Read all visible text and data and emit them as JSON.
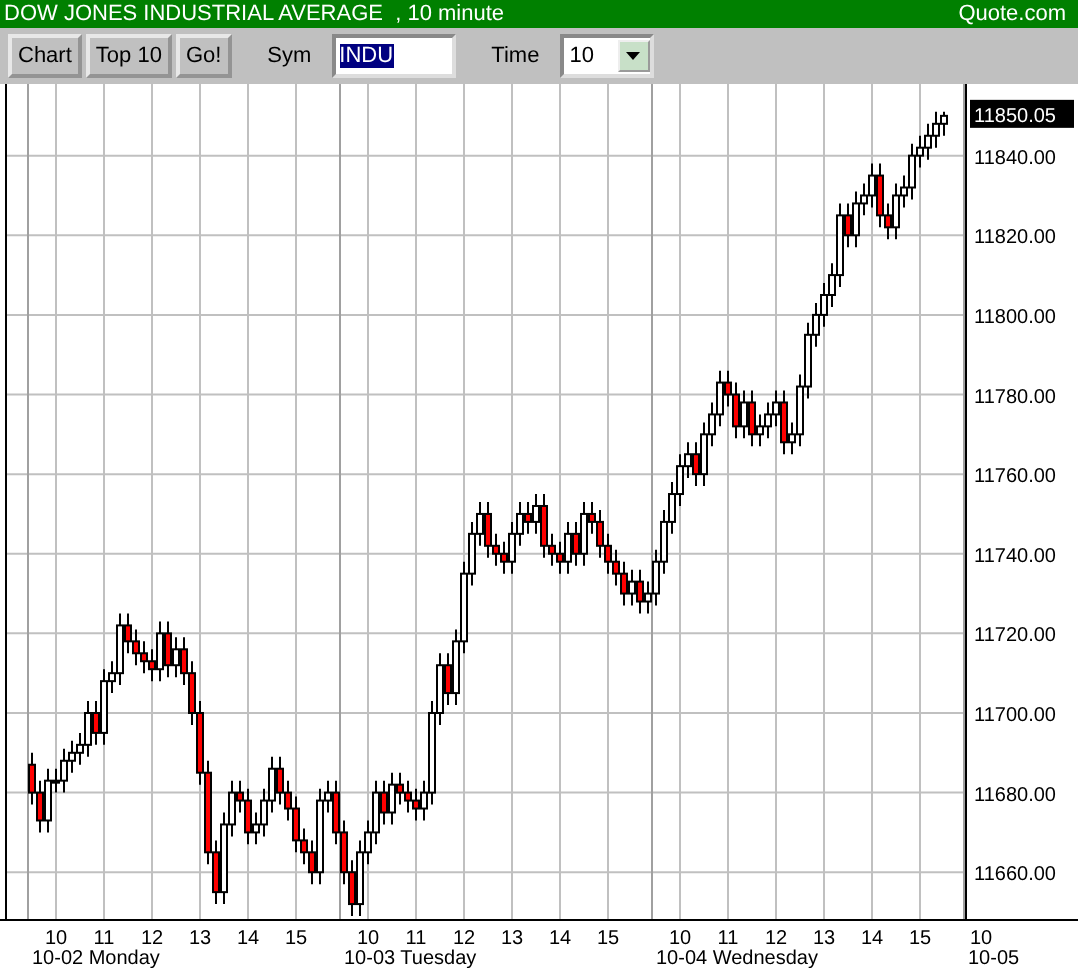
{
  "title_bar": {
    "title": "DOW JONES INDUSTRIAL AVERAGE  , 10 minute",
    "brand": "Quote.com"
  },
  "toolbar": {
    "buttons": [
      "Chart",
      "Top 10",
      "Go!"
    ],
    "symbol": {
      "label": "Sym",
      "value": "INDU",
      "text_selected": true
    },
    "time": {
      "label": "Time",
      "value": "10"
    }
  },
  "chart": {
    "last_price": "11850.05",
    "day_labels": [
      "10-02 Monday",
      "10-03 Tuesday",
      "10-04 Wednesday",
      "10-05"
    ],
    "next_session_hour": "10",
    "chart_data": {
      "type": "candlestick",
      "grid": true,
      "ylim": [
        11648,
        11858
      ],
      "yticks": [
        {
          "value": 11660,
          "label": "11660.00"
        },
        {
          "value": 11680,
          "label": "11680.00"
        },
        {
          "value": 11700,
          "label": "11700.00"
        },
        {
          "value": 11720,
          "label": "11720.00"
        },
        {
          "value": 11740,
          "label": "11740.00"
        },
        {
          "value": 11760,
          "label": "11760.00"
        },
        {
          "value": 11780,
          "label": "11780.00"
        },
        {
          "value": 11800,
          "label": "11800.00"
        },
        {
          "value": 11820,
          "label": "11820.00"
        },
        {
          "value": 11840,
          "label": "11840.00"
        }
      ],
      "categories": [
        null,
        null,
        null,
        "10",
        null,
        null,
        null,
        null,
        null,
        "11",
        null,
        null,
        null,
        null,
        null,
        "12",
        null,
        null,
        null,
        null,
        null,
        "13",
        null,
        null,
        null,
        null,
        null,
        "14",
        null,
        null,
        null,
        null,
        null,
        "15",
        null,
        null,
        null,
        null,
        null,
        null,
        null,
        null,
        "10",
        null,
        null,
        null,
        null,
        null,
        "11",
        null,
        null,
        null,
        null,
        null,
        "12",
        null,
        null,
        null,
        null,
        null,
        "13",
        null,
        null,
        null,
        null,
        null,
        "14",
        null,
        null,
        null,
        null,
        null,
        "15",
        null,
        null,
        null,
        null,
        null,
        null,
        null,
        null,
        "10",
        null,
        null,
        null,
        null,
        null,
        "11",
        null,
        null,
        null,
        null,
        null,
        "12",
        null,
        null,
        null,
        null,
        null,
        "13",
        null,
        null,
        null,
        null,
        null,
        "14",
        null,
        null,
        null,
        null,
        null,
        "15",
        null,
        null,
        null
      ],
      "ohlc": [
        [
          11687,
          11690,
          11677,
          11680
        ],
        [
          11680,
          11683,
          11670,
          11673
        ],
        [
          11673,
          11686,
          11670,
          11683
        ],
        [
          11683,
          11686,
          11680,
          11683
        ],
        [
          11683,
          11691,
          11680,
          11688
        ],
        [
          11688,
          11693,
          11685,
          11690
        ],
        [
          11690,
          11695,
          11687,
          11692
        ],
        [
          11692,
          11703,
          11689,
          11700
        ],
        [
          11700,
          11703,
          11692,
          11695
        ],
        [
          11695,
          11711,
          11692,
          11708
        ],
        [
          11708,
          11713,
          11705,
          11710
        ],
        [
          11710,
          11725,
          11707,
          11722
        ],
        [
          11722,
          11725,
          11715,
          11718
        ],
        [
          11718,
          11721,
          11712,
          11715
        ],
        [
          11715,
          11718,
          11710,
          11713
        ],
        [
          11713,
          11716,
          11708,
          11711
        ],
        [
          11711,
          11723,
          11708,
          11720
        ],
        [
          11720,
          11723,
          11709,
          11712
        ],
        [
          11712,
          11719,
          11709,
          11716
        ],
        [
          11716,
          11719,
          11707,
          11710
        ],
        [
          11710,
          11713,
          11697,
          11700
        ],
        [
          11700,
          11703,
          11682,
          11685
        ],
        [
          11685,
          11688,
          11662,
          11665
        ],
        [
          11665,
          11668,
          11652,
          11655
        ],
        [
          11655,
          11675,
          11652,
          11672
        ],
        [
          11672,
          11683,
          11669,
          11680
        ],
        [
          11680,
          11683,
          11675,
          11678
        ],
        [
          11678,
          11681,
          11667,
          11670
        ],
        [
          11670,
          11675,
          11667,
          11672
        ],
        [
          11672,
          11681,
          11669,
          11678
        ],
        [
          11678,
          11689,
          11675,
          11686
        ],
        [
          11686,
          11689,
          11677,
          11680
        ],
        [
          11680,
          11683,
          11673,
          11676
        ],
        [
          11676,
          11679,
          11665,
          11668
        ],
        [
          11668,
          11671,
          11662,
          11665
        ],
        [
          11665,
          11668,
          11657,
          11660
        ],
        [
          11660,
          11681,
          11657,
          11678
        ],
        [
          11678,
          11683,
          11675,
          11680
        ],
        [
          11680,
          11683,
          11667,
          11670
        ],
        [
          11670,
          11673,
          11657,
          11660
        ],
        [
          11660,
          11663,
          11649,
          11652
        ],
        [
          11652,
          11668,
          11649,
          11665
        ],
        [
          11665,
          11673,
          11662,
          11670
        ],
        [
          11670,
          11683,
          11667,
          11680
        ],
        [
          11680,
          11683,
          11672,
          11675
        ],
        [
          11675,
          11685,
          11672,
          11682
        ],
        [
          11682,
          11685,
          11677,
          11680
        ],
        [
          11680,
          11683,
          11675,
          11678
        ],
        [
          11678,
          11681,
          11673,
          11676
        ],
        [
          11676,
          11683,
          11673,
          11680
        ],
        [
          11680,
          11703,
          11677,
          11700
        ],
        [
          11700,
          11715,
          11697,
          11712
        ],
        [
          11712,
          11715,
          11702,
          11705
        ],
        [
          11705,
          11721,
          11702,
          11718
        ],
        [
          11718,
          11738,
          11715,
          11735
        ],
        [
          11735,
          11748,
          11732,
          11745
        ],
        [
          11745,
          11753,
          11742,
          11750
        ],
        [
          11750,
          11753,
          11739,
          11742
        ],
        [
          11742,
          11745,
          11737,
          11740
        ],
        [
          11740,
          11743,
          11735,
          11738
        ],
        [
          11738,
          11748,
          11735,
          11745
        ],
        [
          11745,
          11753,
          11742,
          11750
        ],
        [
          11750,
          11753,
          11745,
          11748
        ],
        [
          11748,
          11755,
          11745,
          11752
        ],
        [
          11752,
          11755,
          11739,
          11742
        ],
        [
          11742,
          11745,
          11737,
          11740
        ],
        [
          11740,
          11743,
          11735,
          11738
        ],
        [
          11738,
          11748,
          11735,
          11745
        ],
        [
          11745,
          11748,
          11737,
          11740
        ],
        [
          11740,
          11753,
          11737,
          11750
        ],
        [
          11750,
          11753,
          11745,
          11748
        ],
        [
          11748,
          11751,
          11739,
          11742
        ],
        [
          11742,
          11745,
          11735,
          11738
        ],
        [
          11738,
          11741,
          11732,
          11735
        ],
        [
          11735,
          11738,
          11727,
          11730
        ],
        [
          11730,
          11736,
          11727,
          11733
        ],
        [
          11733,
          11736,
          11725,
          11728
        ],
        [
          11728,
          11733,
          11725,
          11730
        ],
        [
          11730,
          11741,
          11727,
          11738
        ],
        [
          11738,
          11751,
          11735,
          11748
        ],
        [
          11748,
          11758,
          11745,
          11755
        ],
        [
          11755,
          11765,
          11752,
          11762
        ],
        [
          11762,
          11768,
          11759,
          11765
        ],
        [
          11765,
          11768,
          11757,
          11760
        ],
        [
          11760,
          11773,
          11757,
          11770
        ],
        [
          11770,
          11778,
          11767,
          11775
        ],
        [
          11775,
          11786,
          11772,
          11783
        ],
        [
          11783,
          11786,
          11777,
          11780
        ],
        [
          11780,
          11783,
          11769,
          11772
        ],
        [
          11772,
          11781,
          11769,
          11778
        ],
        [
          11778,
          11781,
          11767,
          11770
        ],
        [
          11770,
          11775,
          11767,
          11772
        ],
        [
          11772,
          11778,
          11769,
          11775
        ],
        [
          11775,
          11781,
          11772,
          11778
        ],
        [
          11778,
          11781,
          11765,
          11768
        ],
        [
          11768,
          11773,
          11765,
          11770
        ],
        [
          11770,
          11785,
          11767,
          11782
        ],
        [
          11782,
          11798,
          11779,
          11795
        ],
        [
          11795,
          11803,
          11792,
          11800
        ],
        [
          11800,
          11808,
          11797,
          11805
        ],
        [
          11805,
          11813,
          11802,
          11810
        ],
        [
          11810,
          11828,
          11807,
          11825
        ],
        [
          11825,
          11828,
          11817,
          11820
        ],
        [
          11820,
          11831,
          11817,
          11828
        ],
        [
          11828,
          11833,
          11825,
          11830
        ],
        [
          11830,
          11838,
          11827,
          11835
        ],
        [
          11835,
          11838,
          11822,
          11825
        ],
        [
          11825,
          11828,
          11819,
          11822
        ],
        [
          11822,
          11833,
          11819,
          11830
        ],
        [
          11830,
          11835,
          11827,
          11832
        ],
        [
          11832,
          11843,
          11829,
          11840
        ],
        [
          11840,
          11845,
          11837,
          11842
        ],
        [
          11842,
          11848,
          11839,
          11845
        ],
        [
          11845,
          11851,
          11842,
          11848
        ],
        [
          11848,
          11851,
          11845,
          11850
        ]
      ]
    }
  }
}
